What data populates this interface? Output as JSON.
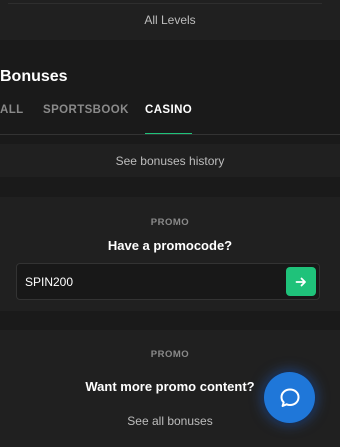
{
  "levels": {
    "link_label": "All Levels"
  },
  "bonuses": {
    "title": "Bonuses",
    "tabs": [
      {
        "label": "ALL",
        "active": false
      },
      {
        "label": "SPORTSBOOK",
        "active": false
      },
      {
        "label": "CASINO",
        "active": true
      }
    ],
    "history_label": "See bonuses history"
  },
  "promo_card": {
    "label": "PROMO",
    "heading": "Have a promocode?",
    "input_value": "SPIN200"
  },
  "more_card": {
    "label": "PROMO",
    "heading": "Want more promo content?",
    "link_label": "See all bonuses"
  },
  "colors": {
    "accent": "#1fc27a",
    "chat": "#1f77d9",
    "background": "#1a1a1a",
    "panel": "#202020"
  },
  "icons": {
    "submit": "arrow-right-icon",
    "chat": "chat-bubble-icon"
  }
}
